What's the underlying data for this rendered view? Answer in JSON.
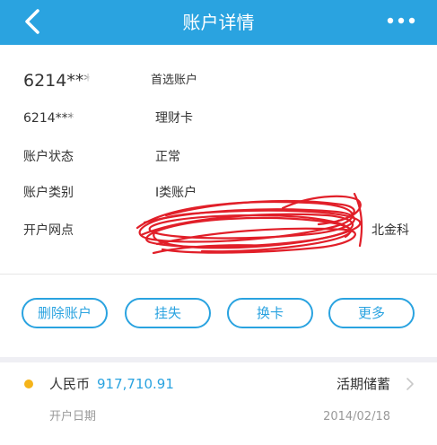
{
  "header": {
    "title": "账户详情",
    "back_icon": "chevron-left-icon",
    "more_icon": "more-dots-icon"
  },
  "colors": {
    "header_bg": "#2aa3e0",
    "accent": "#2aa3e0",
    "amount": "#2aa3e0",
    "dot": "#f5b41a",
    "redaction": "#e0141e"
  },
  "details": {
    "primary_account_number": "6214***",
    "primary_account_tag": "首选账户",
    "card_number": "6214***",
    "card_type": "理财卡",
    "status_label": "账户状态",
    "status_value": "正常",
    "category_label": "账户类别",
    "category_value": "I类账户",
    "branch_label": "开户网点",
    "branch_value_fragment": "北金科"
  },
  "actions": [
    {
      "label": "删除账户"
    },
    {
      "label": "挂失"
    },
    {
      "label": "换卡"
    },
    {
      "label": "更多"
    }
  ],
  "account": {
    "currency": "人民币",
    "amount": "917,710.91",
    "type": "活期储蓄",
    "open_date_label": "开户日期",
    "open_date_value": "2014/02/18"
  }
}
